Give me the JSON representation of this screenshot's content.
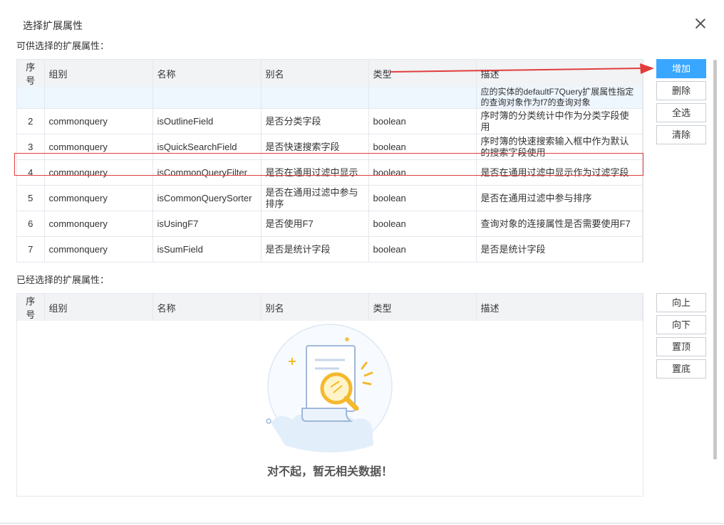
{
  "dialog": {
    "title": "选择扩展属性"
  },
  "available": {
    "label": "可供选择的扩展属性：",
    "columns": [
      "序号",
      "组别",
      "名称",
      "别名",
      "类型",
      "描述"
    ],
    "partial_row_desc": "应的实体的defaultF7Query扩展属性指定的查询对象作为f7的查询对象",
    "rows": [
      {
        "no": "2",
        "group": "commonquery",
        "name": "isOutlineField",
        "alias": "是否分类字段",
        "type": "boolean",
        "desc": "序时簿的分类统计中作为分类字段使用"
      },
      {
        "no": "3",
        "group": "commonquery",
        "name": "isQuickSearchField",
        "alias": "是否快速搜索字段",
        "type": "boolean",
        "desc": "序时簿的快速搜索输入框中作为默认的搜索字段使用"
      },
      {
        "no": "4",
        "group": "commonquery",
        "name": "isCommonQueryFilter",
        "alias": "是否在通用过滤中显示",
        "type": "boolean",
        "desc": "是否在通用过滤中显示作为过滤字段"
      },
      {
        "no": "5",
        "group": "commonquery",
        "name": "isCommonQuerySorter",
        "alias": "是否在通用过滤中参与排序",
        "type": "boolean",
        "desc": "是否在通用过滤中参与排序"
      },
      {
        "no": "6",
        "group": "commonquery",
        "name": "isUsingF7",
        "alias": "是否使用F7",
        "type": "boolean",
        "desc": "查询对象的连接属性是否需要使用F7"
      },
      {
        "no": "7",
        "group": "commonquery",
        "name": "isSumField",
        "alias": "是否是统计字段",
        "type": "boolean",
        "desc": "是否是统计字段"
      }
    ]
  },
  "buttons_top": {
    "add": "增加",
    "delete": "删除",
    "select_all": "全选",
    "clear": "清除"
  },
  "selected": {
    "label": "已经选择的扩展属性：",
    "columns": [
      "序号",
      "组别",
      "名称",
      "别名",
      "类型",
      "描述"
    ],
    "empty_text": "对不起，暂无相关数据！"
  },
  "buttons_bottom": {
    "up": "向上",
    "down": "向下",
    "top": "置顶",
    "bottom": "置底"
  },
  "colors": {
    "primary": "#39a7ff",
    "highlight": "#e23d3d",
    "header_bg": "#f1f3f5"
  }
}
